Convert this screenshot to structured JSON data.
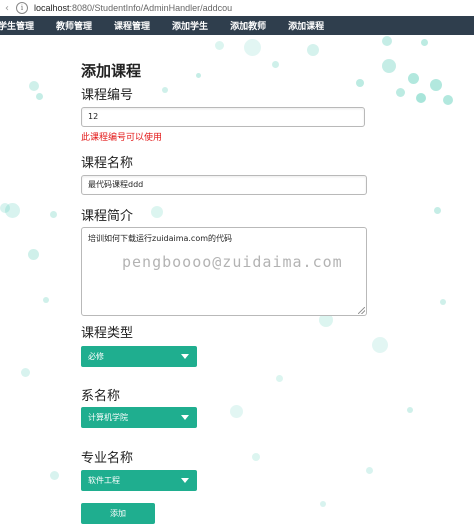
{
  "address_bar": {
    "host": "localhost",
    "path": ":8080/StudentInfo/AdminHandler/addcou"
  },
  "nav": {
    "items": [
      "学生管理",
      "教师管理",
      "课程管理",
      "添加学生",
      "添加教师",
      "添加课程"
    ]
  },
  "form": {
    "title": "添加课程",
    "course_id": {
      "label": "课程编号",
      "value": "12",
      "note": "此课程编号可以使用"
    },
    "course_name": {
      "label": "课程名称",
      "value": "最代码课程ddd"
    },
    "course_intro": {
      "label": "课程简介",
      "value": "培训如何下载运行zuidaima.com的代码"
    },
    "course_type": {
      "label": "课程类型",
      "value": "必修"
    },
    "department": {
      "label": "系名称",
      "value": "计算机学院"
    },
    "major": {
      "label": "专业名称",
      "value": "软件工程"
    },
    "submit_label": "添加"
  },
  "watermark": "pengboooo@zuidaima.com",
  "colors": {
    "navbar": "#2f3e4d",
    "accent": "#1fae8f",
    "bubble": "#3ec5ad",
    "note": "#e31818"
  }
}
